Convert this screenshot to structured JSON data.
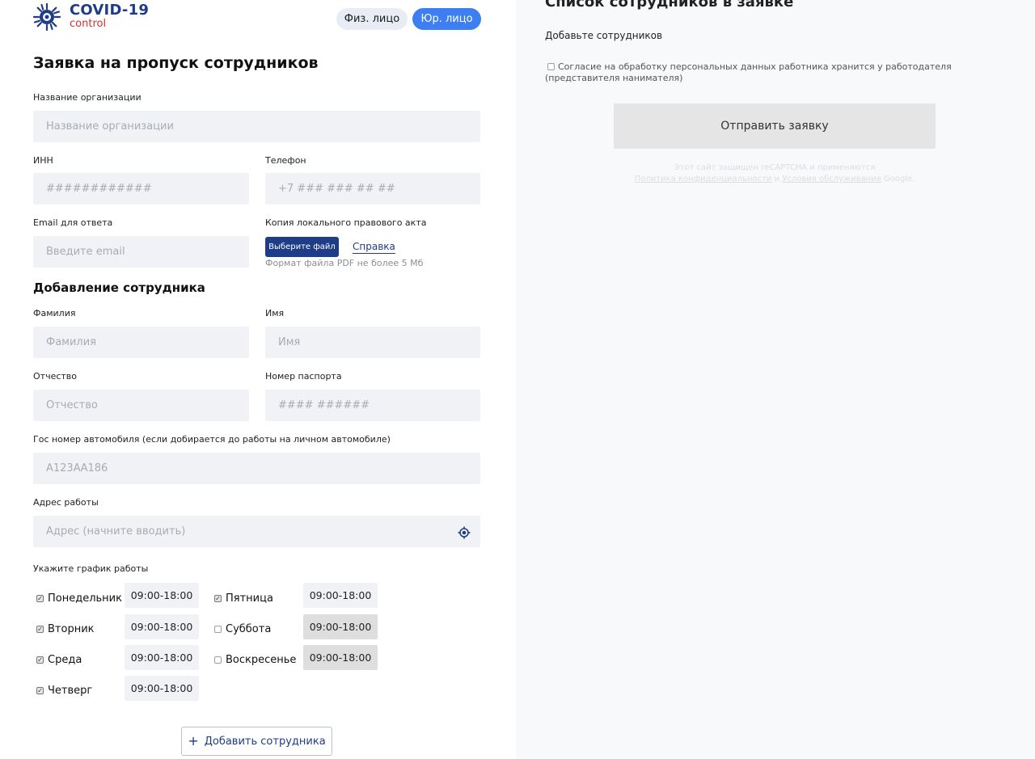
{
  "logo": {
    "title": "COVID-19",
    "subtitle": "control"
  },
  "toggle": {
    "fiz": "Физ. лицо",
    "yur": "Юр. лицо"
  },
  "form": {
    "title": "Заявка на пропуск сотрудников",
    "org": {
      "label": "Название организации",
      "placeholder": "Название организации"
    },
    "inn": {
      "label": "ИНН",
      "placeholder": "############"
    },
    "phone": {
      "label": "Телефон",
      "placeholder": "+7 ### ### ## ##"
    },
    "email": {
      "label": "Email для ответа",
      "placeholder": "Введите email"
    },
    "act": {
      "label": "Копия локального правового акта",
      "button": "Выберите файл",
      "help": "Справка",
      "hint": "Формат файла PDF не более 5 Мб"
    }
  },
  "employee": {
    "title": "Добавление сотрудника",
    "lastname": {
      "label": "Фамилия",
      "placeholder": "Фамилия"
    },
    "firstname": {
      "label": "Имя",
      "placeholder": "Имя"
    },
    "middlename": {
      "label": "Отчество",
      "placeholder": "Отчество"
    },
    "passport": {
      "label": "Номер паспорта",
      "placeholder": "#### ######"
    },
    "car": {
      "label": "Гос номер автомобиля (если добирается до работы на личном автомобиле)",
      "placeholder": "А123АА186"
    },
    "address": {
      "label": "Адрес работы",
      "placeholder": "Адрес (начните вводить)"
    },
    "schedule": {
      "label": "Укажите график работы",
      "days": [
        {
          "name": "Понедельник",
          "checked": true,
          "time": "09:00-18:00"
        },
        {
          "name": "Вторник",
          "checked": true,
          "time": "09:00-18:00"
        },
        {
          "name": "Среда",
          "checked": true,
          "time": "09:00-18:00"
        },
        {
          "name": "Четверг",
          "checked": true,
          "time": "09:00-18:00"
        },
        {
          "name": "Пятница",
          "checked": true,
          "time": "09:00-18:00"
        },
        {
          "name": "Суббота",
          "checked": false,
          "time": "09:00-18:00"
        },
        {
          "name": "Воскресенье",
          "checked": false,
          "time": "09:00-18:00"
        }
      ]
    },
    "add_button": "Добавить сотрудника"
  },
  "right": {
    "title": "Список сотрудников в заявке",
    "subtitle": "Добавьте сотрудников",
    "consent": "Согласие на обработку персональных данных работника хранится у работодателя (представителя нанимателя)",
    "submit": "Отправить заявку",
    "recaptcha": {
      "line1": "Этот сайт защищен reCAPTCHA и применяются",
      "privacy": "Политика конфиденциальности",
      "and": "и",
      "terms": "Условия обслуживания",
      "tail": "Google."
    }
  },
  "colors": {
    "brand": "#1f3c88",
    "accent": "#3d7ff3",
    "logo_red": "#d32f2f"
  },
  "icons": {
    "logo": "virus-icon",
    "geo": "location-target-icon",
    "add": "plus-icon",
    "check": "check-icon"
  }
}
